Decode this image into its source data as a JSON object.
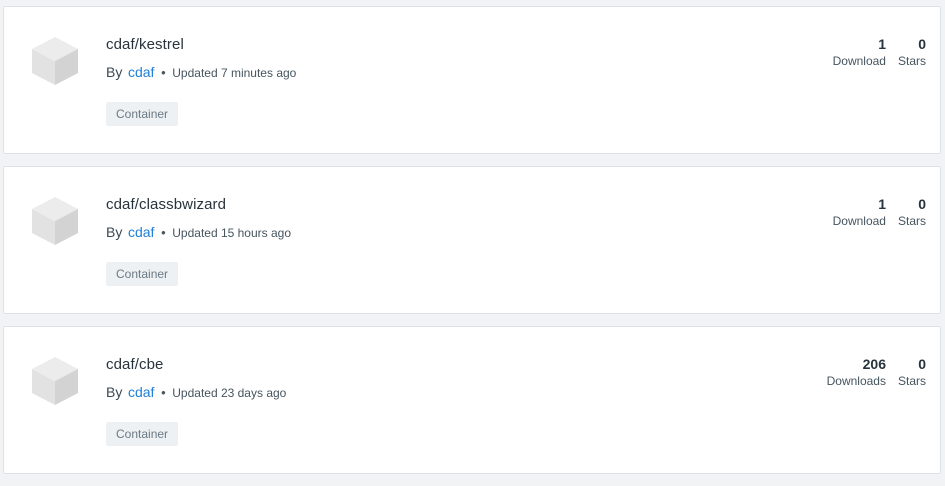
{
  "repos": [
    {
      "name": "cdaf/kestrel",
      "by": "By",
      "author": "cdaf",
      "separator": "•",
      "updated": "Updated 7 minutes ago",
      "type": "Container",
      "downloads": "1",
      "downloads_label": "Download",
      "stars": "0",
      "stars_label": "Stars",
      "icon": "cube-icon"
    },
    {
      "name": "cdaf/classbwizard",
      "by": "By",
      "author": "cdaf",
      "separator": "•",
      "updated": "Updated 15 hours ago",
      "type": "Container",
      "downloads": "1",
      "downloads_label": "Download",
      "stars": "0",
      "stars_label": "Stars",
      "icon": "cube-icon"
    },
    {
      "name": "cdaf/cbe",
      "by": "By",
      "author": "cdaf",
      "separator": "•",
      "updated": "Updated 23 days ago",
      "type": "Container",
      "downloads": "206",
      "downloads_label": "Downloads",
      "stars": "0",
      "stars_label": "Stars",
      "icon": "cube-icon"
    }
  ],
  "colors": {
    "link": "#1f7fd3",
    "text": "#27343d",
    "badge_bg": "#eef1f4",
    "page_bg": "#f2f3f5"
  }
}
